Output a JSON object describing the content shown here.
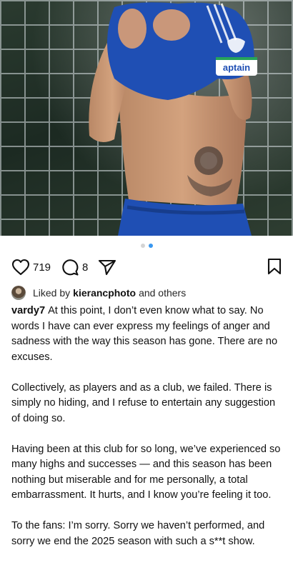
{
  "post": {
    "likes_count": "719",
    "comments_count": "8",
    "carousel": {
      "total": 2,
      "active_index": 1
    },
    "liked_by": {
      "prefix": "Liked by",
      "user": "kierancphoto",
      "suffix": "and others"
    },
    "photo": {
      "armband_text": "aptain"
    },
    "caption": {
      "username": "vardy7",
      "paragraphs": [
        "At this point, I don’t even know what to say. No words I have can ever express my feelings of anger and sadness with the way this season has gone. There are no excuses.",
        "Collectively, as players and as a club, we failed. There is simply no hiding, and I refuse to entertain any suggestion of doing so.",
        "Having been at this club for so long, we’ve experienced so many highs and successes — and this season has been nothing but miserable and for me personally, a total embarrassment. It hurts, and I know you’re feeling it too.",
        "To the fans: I’m sorry. Sorry we haven’t performed, and sorry we end the 2025 season with such a s**t show."
      ]
    }
  },
  "icons": {
    "like": "heart-icon",
    "comment": "comment-bubble-icon",
    "share": "paper-plane-icon",
    "save": "bookmark-icon"
  },
  "colors": {
    "background": "#ffffff",
    "text": "#111111",
    "carousel_active": "#3897f0",
    "carousel_inactive": "#d4d4d4",
    "kit_blue": "#1f4fb4"
  }
}
